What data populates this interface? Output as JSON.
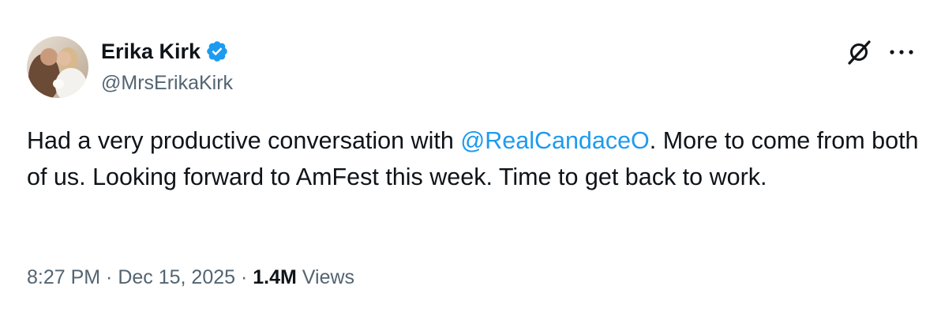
{
  "author": {
    "display_name": "Erika Kirk",
    "handle": "@MrsErikaKirk",
    "verified": true,
    "verified_color": "#1d9bf0"
  },
  "tweet": {
    "text_before_mention": "Had a very productive conversation with ",
    "mention": "@RealCandaceO",
    "text_after_mention": ". More to come from both of us. Looking forward to AmFest this week. Time to get back to work.",
    "mention_color": "#1d9bf0"
  },
  "meta": {
    "time": "8:27 PM",
    "separator": " · ",
    "date": "Dec 15, 2025",
    "views_count": "1.4M",
    "views_label": " Views"
  },
  "icons": {
    "grok": "grok-icon",
    "more": "more-icon",
    "verified": "verified-badge-icon"
  },
  "colors": {
    "primary_text": "#0f1419",
    "secondary_text": "#536471",
    "accent": "#1d9bf0"
  }
}
